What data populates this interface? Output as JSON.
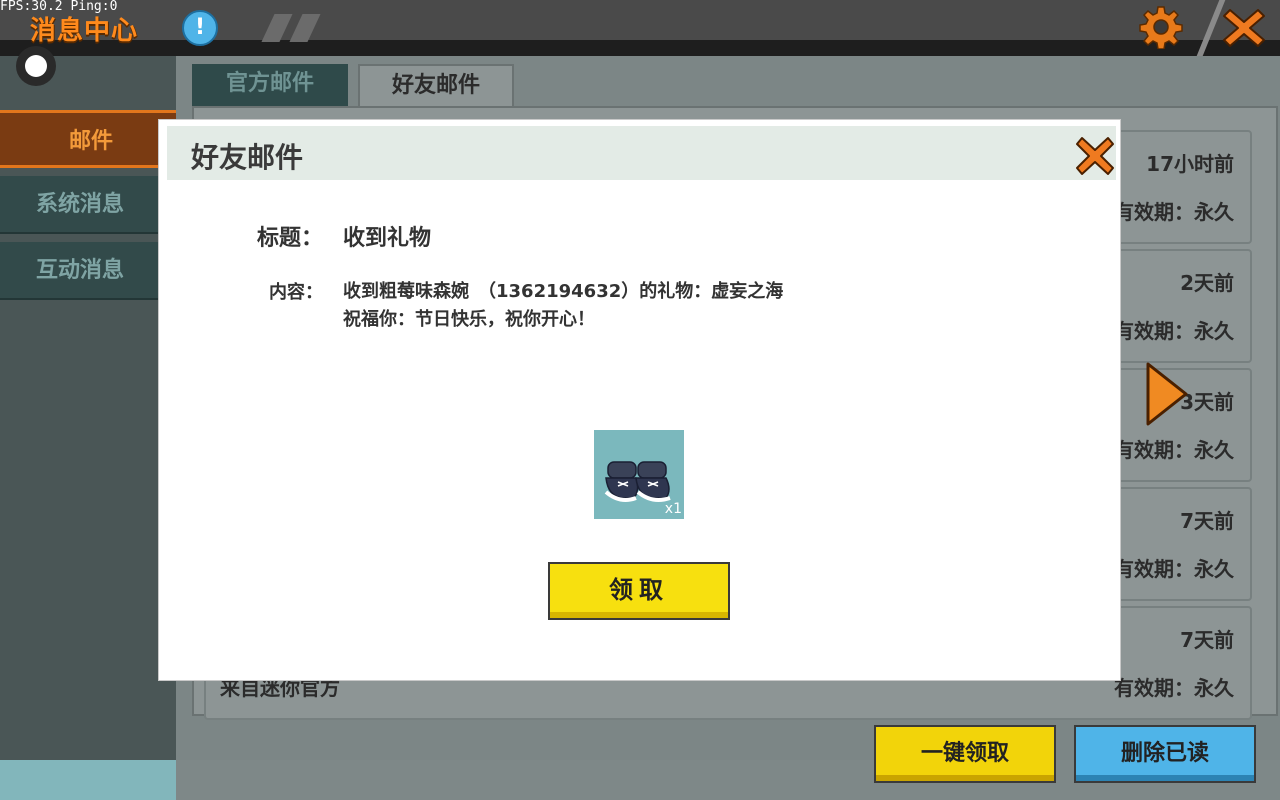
{
  "hud": {
    "fps_text": "FPS:30.2  Ping:0"
  },
  "header": {
    "title": "消息中心",
    "alert_icon": "!"
  },
  "sidebar": {
    "items": [
      {
        "label": "邮件",
        "active": true
      },
      {
        "label": "系统消息",
        "active": false
      },
      {
        "label": "互动消息",
        "active": false
      }
    ]
  },
  "tabs": [
    {
      "label": "官方邮件",
      "active": false
    },
    {
      "label": "好友邮件",
      "active": true
    }
  ],
  "mail_list": [
    {
      "time": "17小时前",
      "validity": "有效期：永久"
    },
    {
      "time": "2天前",
      "validity": "有效期：永久"
    },
    {
      "time": "3天前",
      "validity": "有效期：永久"
    },
    {
      "time": "7天前",
      "validity": "有效期：永久"
    },
    {
      "time": "7天前",
      "validity": "有效期：永久",
      "from": "来自迷你官方"
    }
  ],
  "bottom_buttons": {
    "claim_all": "一键领取",
    "delete_read": "删除已读"
  },
  "modal": {
    "title": "好友邮件",
    "title_label": "标题：",
    "title_value": "收到礼物",
    "content_label": "内容：",
    "content_line1": "收到粗莓味森婉　（1362194632）的礼物：虚妄之海",
    "content_line2": "祝福你：节日快乐，祝你开心！",
    "gift_qty": "x1",
    "claim_label": "领取"
  },
  "colors": {
    "accent_orange": "#ff8a1c",
    "button_yellow": "#f7e00f",
    "button_blue": "#4fb4e8",
    "sidebar_active": "#7a3b12"
  },
  "icons": [
    "alert-icon",
    "gear-icon",
    "close-icon",
    "arrow-right-icon",
    "sneakers-icon"
  ]
}
